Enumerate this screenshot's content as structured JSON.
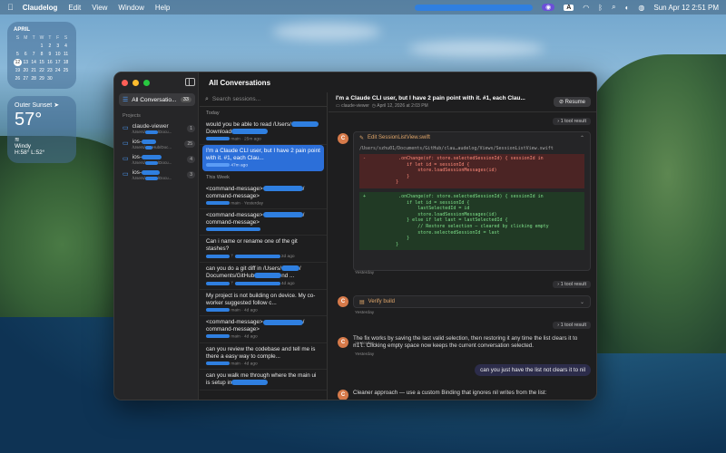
{
  "menubar": {
    "app_name": "Claudelog",
    "items": [
      "Edit",
      "View",
      "Window",
      "Help"
    ],
    "kbd": "A",
    "clock": "Sun Apr 12  2:51 PM"
  },
  "calendar": {
    "month": "APRIL",
    "weekdays": [
      "S",
      "M",
      "T",
      "W",
      "T",
      "F",
      "S"
    ],
    "days": [
      "",
      "",
      "",
      "1",
      "2",
      "3",
      "4",
      "5",
      "6",
      "7",
      "8",
      "9",
      "10",
      "11",
      "12",
      "13",
      "14",
      "15",
      "16",
      "17",
      "18",
      "19",
      "20",
      "21",
      "22",
      "23",
      "24",
      "25",
      "26",
      "27",
      "28",
      "29",
      "30",
      "",
      ""
    ],
    "today": "12"
  },
  "weather": {
    "location": "Outer Sunset",
    "temp": "57°",
    "condition": "Windy",
    "hilo": "H:58° L:52°"
  },
  "window": {
    "title": "All Conversations"
  },
  "sidebar": {
    "all_label": "All Conversatio...",
    "all_count": "33",
    "section": "Projects",
    "projects": [
      {
        "name": "claude-viewer",
        "path": "/Users/",
        "path2": "/Docu...",
        "count": "1"
      },
      {
        "name": "ios-",
        "path": "/Users/",
        "path2": "Hub/Doc...",
        "count": "25"
      },
      {
        "name": "ios-",
        "path": "/Users/",
        "path2": "/Docu...",
        "count": "4"
      },
      {
        "name": "ios-",
        "path": "/Users/",
        "path2": "/Docu...",
        "count": "3"
      }
    ]
  },
  "sessions": {
    "search_placeholder": "Search sessions...",
    "group_today": "Today",
    "group_week": "This Week",
    "today": [
      {
        "msg": "would you be able to read /Users/",
        "msg2": "Download",
        "meta": "main · 25m ago"
      },
      {
        "msg": "I'm a Claude CLI user, but I have 2 pain point with it. #1, each Clau...",
        "msg2": "",
        "meta": "47m ago"
      }
    ],
    "week": [
      {
        "msg": "<command-message>",
        "msg2": "command-message>",
        "meta": "main · Yesterday"
      },
      {
        "msg": "<command-message>",
        "msg2": "command-message>",
        "meta": ""
      },
      {
        "msg": "Can i name or rename one of the git stashes?",
        "msg2": "",
        "meta": "2d ago"
      },
      {
        "msg": "can you do a git diff in /Users/",
        "msg2": "Documents/GitHub",
        "meta": "4d ago"
      },
      {
        "msg": "My project is not building on device. My co-worker suggested follow c...",
        "msg2": "",
        "meta": "main · 4d ago"
      },
      {
        "msg": "<command-message>",
        "msg2": "command-message>",
        "meta": "main · 4d ago"
      },
      {
        "msg": "can you review the codebase and tell me is there a easy way to comple...",
        "msg2": "",
        "meta": "main · 4d ago"
      },
      {
        "msg": "can you walk me through where the main ui is setup in",
        "msg2": "",
        "meta": ""
      }
    ]
  },
  "detail": {
    "title": "I'm a Claude CLI user, but I have 2 pain point with it. #1, each Clau...",
    "project": "claude-viewer",
    "date": "April 12, 2026 at 2:03 PM",
    "resume_label": "Resume",
    "tool_result": "1 tool result",
    "edit_label": "Edit SessionListView.swift",
    "edit_path": "/Users/szhu01/Documents/GitHub/clau…audelog/Views/SessionListView.swift",
    "removed_code": "-            .onChange(of: store.selectedSessionId) { sessionId in\n                if let id = sessionId {\n                    store.loadSessionMessages(id)\n                }\n            }",
    "added_code": "+            .onChange(of: store.selectedSessionId) { sessionId in\n                if let id = sessionId {\n                    lastSelectedId = id\n                    store.loadSessionMessages(id)\n                } else if let last = lastSelectedId {\n                    // Restore selection — cleared by clicking empty\n                    store.selectedSessionId = last\n                }\n            }",
    "yesterday": "Yesterday",
    "verify_label": "Verify build",
    "fix_text_1": "The fix works by saving the last valid selection, then restoring it any time the list clears it to ",
    "fix_code": "nil",
    "fix_text_2": ". Clicking empty space now keeps the current conversation selected.",
    "user_msg": "can you just have the list not clears it to nil",
    "cleaner_text": "Cleaner approach — use a custom Binding that ignores nil writes from the list:",
    "avatar": "C"
  }
}
